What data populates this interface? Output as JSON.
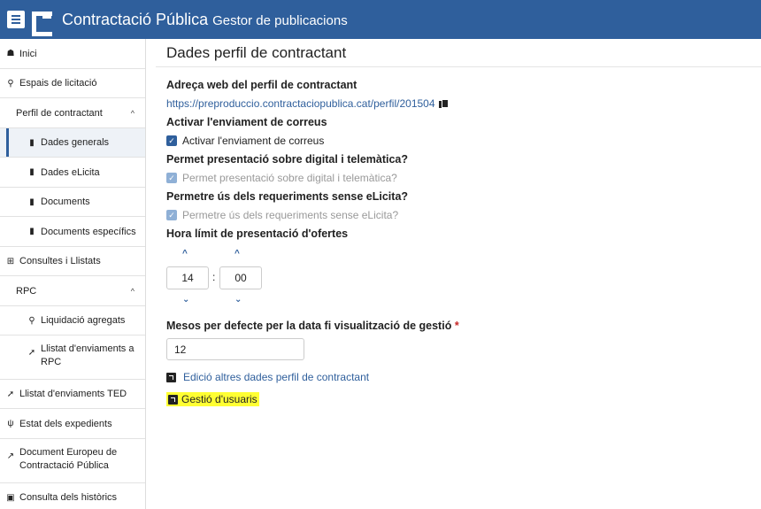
{
  "header": {
    "title": "Contractació Pública",
    "subtitle": "Gestor de publicacions"
  },
  "sidebar": {
    "items": [
      {
        "label": "Inici",
        "icon": "home-icon"
      },
      {
        "label": "Espais de licitació",
        "icon": "search-icon"
      },
      {
        "label": "Perfil de contractant",
        "icon": "",
        "expanded": true
      },
      {
        "label": "Dades generals",
        "icon": "file-icon",
        "active": true
      },
      {
        "label": "Dades eLicita",
        "icon": "file-icon"
      },
      {
        "label": "Documents",
        "icon": "file-icon"
      },
      {
        "label": "Documents específics",
        "icon": "file-icon"
      },
      {
        "label": "Consultes i Llistats",
        "icon": "table-icon"
      },
      {
        "label": "RPC",
        "icon": "",
        "expanded": true
      },
      {
        "label": "Liquidació agregats",
        "icon": "search-icon"
      },
      {
        "label": "Llistat d'enviaments a RPC",
        "icon": "gavel-icon"
      },
      {
        "label": "Llistat d'enviaments TED",
        "icon": "gavel-icon"
      },
      {
        "label": "Estat dels expedients",
        "icon": "tree-icon"
      },
      {
        "label": "Document Europeu de Contractació Pública",
        "icon": "external-link-icon"
      },
      {
        "label": "Consulta dels històrics",
        "icon": "archive-icon"
      }
    ]
  },
  "main": {
    "title": "Dades perfil de contractant",
    "web_label": "Adreça web del perfil de contractant",
    "web_url": "https://preproduccio.contractaciopublica.cat/perfil/201504",
    "email_label": "Activar l'enviament de correus",
    "email_checkbox": "Activar l'enviament de correus",
    "digital_label": "Permet presentació sobre digital i telemàtica?",
    "digital_checkbox": "Permet presentació sobre digital i telemàtica?",
    "elicita_label": "Permetre ús dels requeriments sense eLicita?",
    "elicita_checkbox": "Permetre ús dels requeriments sense eLicita?",
    "hora_label": "Hora límit de presentació d'ofertes",
    "hour": "14",
    "minute": "00",
    "time_sep": ":",
    "mesos_label": "Mesos per defecte per la data fi visualització de gestió",
    "required_mark": "*",
    "mesos_value": "12",
    "edicio_link": "Edició altres dades perfil de contractant",
    "gestio_link": "Gestió d'usuaris"
  },
  "colors": {
    "header_bg": "#2f5f9c",
    "link": "#2f5f9c",
    "highlight": "#ffff33",
    "required": "#c62828"
  }
}
